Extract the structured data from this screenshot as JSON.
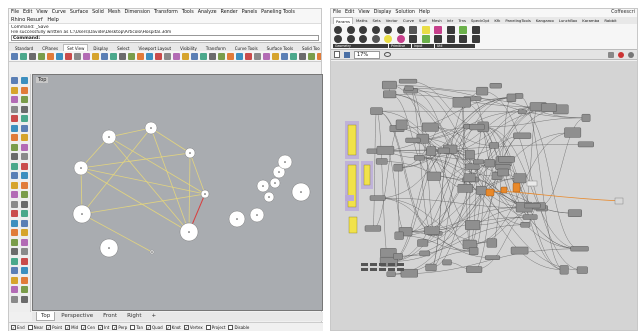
{
  "rhino": {
    "menu": [
      "File",
      "Edit",
      "View",
      "Curve",
      "Surface",
      "Solid",
      "Mesh",
      "Dimension",
      "Transform",
      "Tools",
      "Analyze",
      "Render",
      "Panels",
      "Paneling Tools"
    ],
    "menu2": [
      "Rhino Resurf",
      "Help"
    ],
    "command_history": [
      "Command: _Save",
      "File successfully written as C:\\Users\\Davide\\Desktop\\Articolo\\Hospital.3dm"
    ],
    "command_prompt": "Command:",
    "toolbar_tabs": [
      "Standard",
      "CPlanes",
      "Set View",
      "Display",
      "Select",
      "Viewport Layout",
      "Visibility",
      "Transform",
      "Curve Tools",
      "Surface Tools",
      "Solid Too"
    ],
    "active_toolbar_tab": "Set View",
    "viewport_label": "Top",
    "view_tabs": [
      "Top",
      "Perspective",
      "Front",
      "Right"
    ],
    "add_view_glyph": "+",
    "osnaps": [
      {
        "label": "End",
        "checked": true
      },
      {
        "label": "Near",
        "checked": false
      },
      {
        "label": "Point",
        "checked": true
      },
      {
        "label": "Mid",
        "checked": true
      },
      {
        "label": "Cen",
        "checked": true
      },
      {
        "label": "Int",
        "checked": true
      },
      {
        "label": "Perp",
        "checked": true
      },
      {
        "label": "Tan",
        "checked": false
      },
      {
        "label": "Quad",
        "checked": true
      },
      {
        "label": "Knot",
        "checked": true
      },
      {
        "label": "Vertex",
        "checked": true
      },
      {
        "label": "Project",
        "checked": false
      },
      {
        "label": "Disable",
        "checked": false
      }
    ]
  },
  "grasshopper": {
    "menu": [
      "File",
      "Edit",
      "View",
      "Display",
      "Solution",
      "Help"
    ],
    "window_title": "Coffeescri",
    "tabs": [
      "Params",
      "Maths",
      "Sets",
      "Vector",
      "Curve",
      "Surf",
      "Mesh",
      "Intr",
      "Trns",
      "SpeckOpt",
      "Kfk",
      "PanelingTools",
      "Kangaroo",
      "LunchBox",
      "Karamba",
      "Rabbit"
    ],
    "active_tab": "Params",
    "ribbon_groups": [
      "Geometry",
      "Primitive",
      "Input",
      "Util"
    ],
    "zoom": "17%"
  },
  "colors": {
    "viewport_bg": "#a9acb0",
    "curve_yellow": "#e8d87a",
    "gh_canvas_bg": "#d4d4d4",
    "gh_panel_yellow": "#f1e24a",
    "gh_group_purple": "#b9a9d9",
    "gh_orange": "#e8892b",
    "gh_wire": "#555555"
  }
}
